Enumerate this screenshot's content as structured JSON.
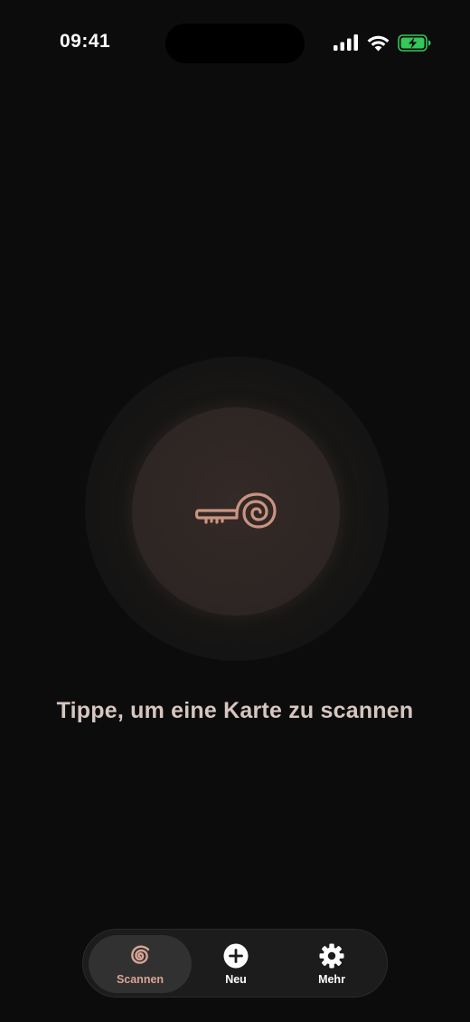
{
  "status_bar": {
    "time": "09:41",
    "icons": [
      "cellular-signal-icon",
      "wifi-icon",
      "battery-charging-icon"
    ],
    "battery_color": "#34c759"
  },
  "scan": {
    "icon": "key-spiral-icon",
    "hint": "Tippe, um eine Karte zu scannen",
    "accent_color": "#c99482"
  },
  "tab_bar": {
    "tabs": [
      {
        "label": "Scannen",
        "icon": "spiral-icon",
        "active": true
      },
      {
        "label": "Neu",
        "icon": "plus-circle-icon",
        "active": false
      },
      {
        "label": "Mehr",
        "icon": "gear-icon",
        "active": false
      }
    ]
  }
}
